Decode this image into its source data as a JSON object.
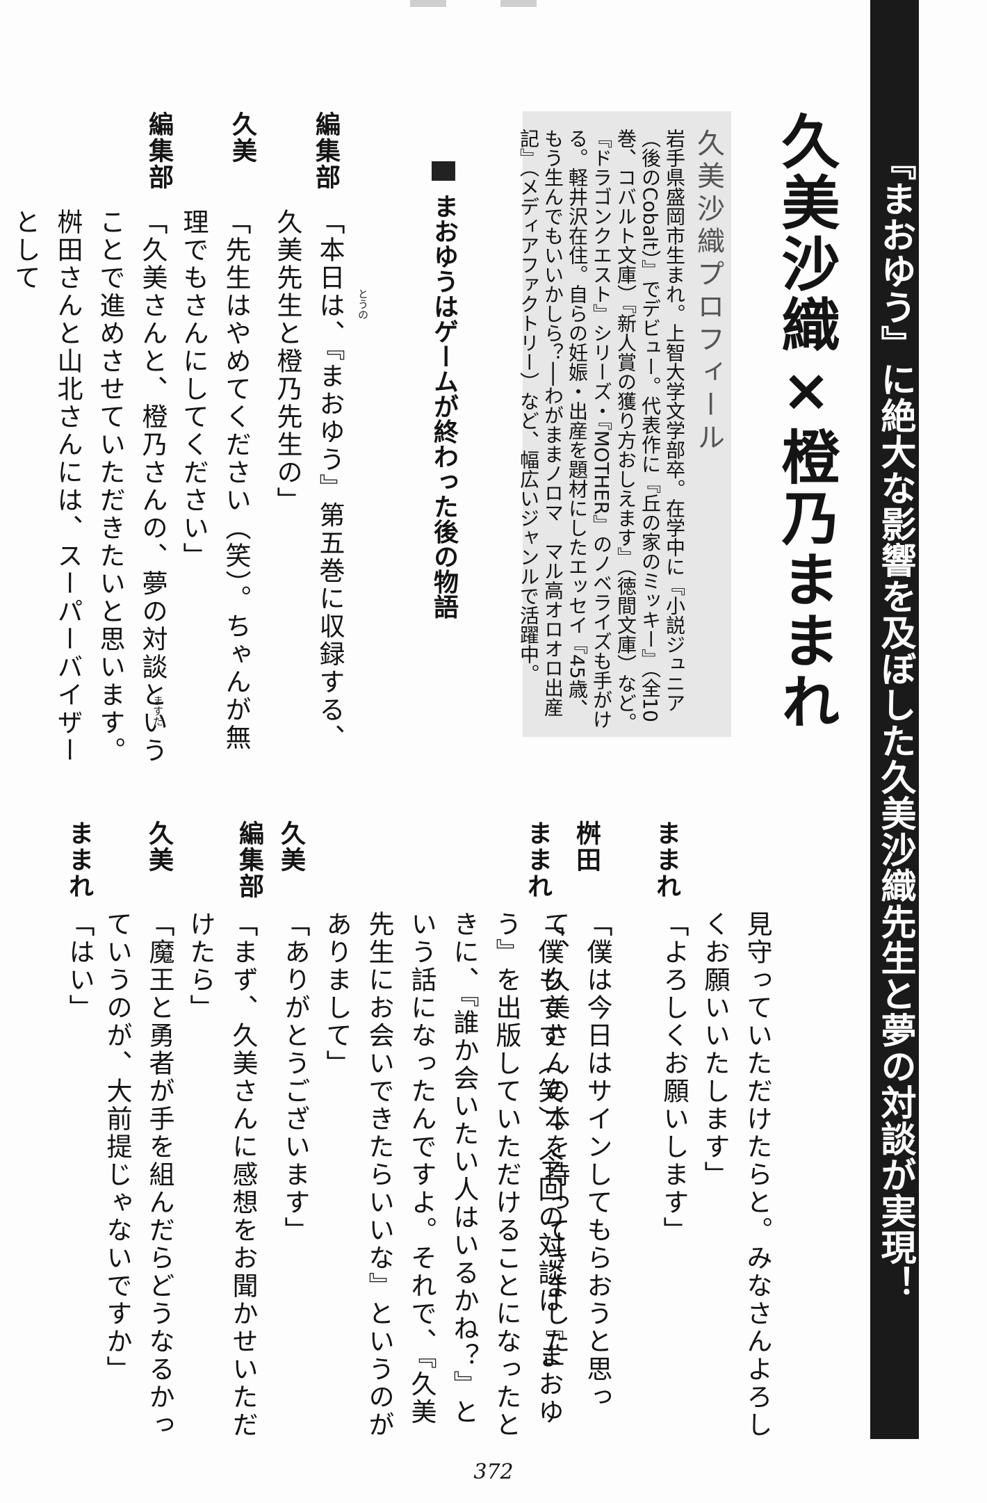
{
  "banner": {
    "title": "『まおゆう』に絶大な影響を及ぼした久美沙織先生と夢の対談が実現！"
  },
  "headline": {
    "text": "久美沙織×橙乃ままれ"
  },
  "profile": {
    "title": "久美沙織プロフィール",
    "body": "岩手県盛岡市生まれ。上智大学文学部卒。在学中に『小説ジュニア（後のCobalt）』でデビュー。代表作に『丘の家のミッキー』（全10巻、コバルト文庫）『新人賞の獲り方おしえます』（徳間文庫）など。『ドラゴンクエスト』シリーズ・『MOTHER』のノベライズも手がける。軽井沢在住。自らの妊娠・出産を題材にしたエッセイ『45歳、もう生んでもいいかしら？──わがままノロマ　マル高オロオロ出産記』（メディアファクトリー）など、幅広いジャンルで活躍中。"
  },
  "section": {
    "heading": "まおゆうはゲームが終わった後の物語"
  },
  "dialogue_top": [
    {
      "speaker": "編集部",
      "text": "「本日は、『まおゆう』第五巻に収録する、久美先生と橙乃先生の」"
    },
    {
      "speaker": "久美",
      "text": "「先生はやめてください（笑）。ちゃんが無理でもさんにしてください」"
    },
    {
      "speaker": "編集部",
      "text": "「久美さんと、橙乃さんの、夢の対談ということで進めさせていただきたいと思います。桝田さんと山北さんには、スーパーバイザーとして"
    }
  ],
  "dialogue_bottom": [
    {
      "speaker": "",
      "text": "見守っていただけたらと。みなさんよろしくお願いいたします」"
    },
    {
      "speaker": "ままれ",
      "text": "「よろしくお願いします」"
    },
    {
      "speaker": "桝田",
      "text": "「僕は今日はサインしてもらおうと思って、久美さんの本を持ってきました」"
    },
    {
      "speaker": "ままれ",
      "text": "「僕もです（笑）。今回の対談は『まおゆう』を出版していただけることになったときに、『誰か会いたい人はいるかね？』という話になったんですよ。それで、『久美先生にお会いできたらいいな』というのがありまして」"
    },
    {
      "speaker": "久美",
      "text": "「ありがとうございます」"
    },
    {
      "speaker": "編集部",
      "text": "「まず、久美さんに感想をお聞かせいただけたら」"
    },
    {
      "speaker": "久美",
      "text": "「魔王と勇者が手を組んだらどうなるかっていうのが、大前提じゃないですか」"
    },
    {
      "speaker": "ままれ",
      "text": "「はい」"
    }
  ],
  "ruby": {
    "touno": "とうの",
    "masuda": "ますだ"
  },
  "page_number": "372"
}
